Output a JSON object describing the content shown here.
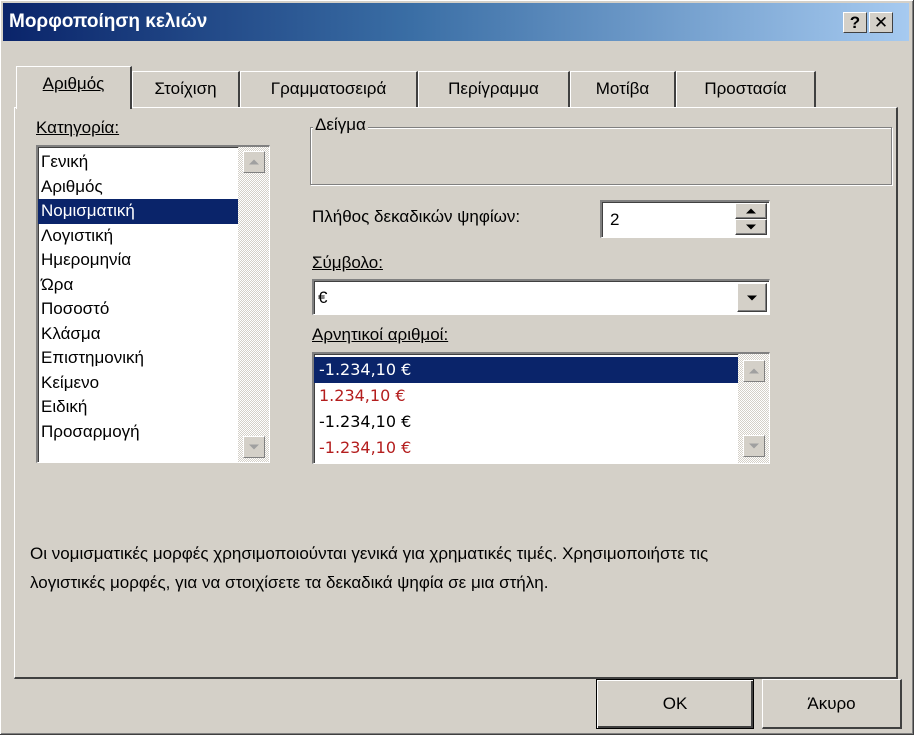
{
  "window": {
    "title": "Μορφοποίηση κελιών",
    "help_label": "?",
    "close_label": "✕"
  },
  "tabs": [
    {
      "label": "Αριθμός",
      "active": true
    },
    {
      "label": "Στοίχιση",
      "active": false
    },
    {
      "label": "Γραμματοσειρά",
      "active": false
    },
    {
      "label": "Περίγραμμα",
      "active": false
    },
    {
      "label": "Μοτίβα",
      "active": false
    },
    {
      "label": "Προστασία",
      "active": false
    }
  ],
  "category": {
    "label": "Κατηγορία:",
    "selected": "Νομισματική",
    "items": [
      "Γενική",
      "Αριθμός",
      "Νομισματική",
      "Λογιστική",
      "Ημερομηνία",
      "Ώρα",
      "Ποσοστό",
      "Κλάσμα",
      "Επιστημονική",
      "Κείμενο",
      "Ειδική",
      "Προσαρμογή"
    ]
  },
  "sample": {
    "label": "Δείγμα",
    "value": ""
  },
  "decimal_places": {
    "label": "Πλήθος δεκαδικών ψηφίων:",
    "value": "2"
  },
  "symbol": {
    "label": "Σύμβολο:",
    "value": "€"
  },
  "negative_numbers": {
    "label": "Αρνητικοί αριθμοί:",
    "items": [
      {
        "text": "-1.234,10 €",
        "color": "#ffffff",
        "selected": true
      },
      {
        "text": "1.234,10 €",
        "color": "#b41e1e",
        "selected": false
      },
      {
        "text": "-1.234,10 €",
        "color": "#000000",
        "selected": false
      },
      {
        "text": "-1.234,10 €",
        "color": "#b41e1e",
        "selected": false
      }
    ]
  },
  "description": {
    "line1": "Οι νομισματικές μορφές χρησιμοποιούνται γενικά για χρηματικές τιμές. Χρησιμοποιήστε τις",
    "line2": "λογιστικές μορφές, για να στοιχίσετε τα δεκαδικά ψηφία σε μια στήλη."
  },
  "buttons": {
    "ok": "OK",
    "cancel": "Άκυρο"
  },
  "colors": {
    "selection": "#0a246a",
    "negative_red": "#b41e1e",
    "dialog_face": "#d4d0c8"
  }
}
